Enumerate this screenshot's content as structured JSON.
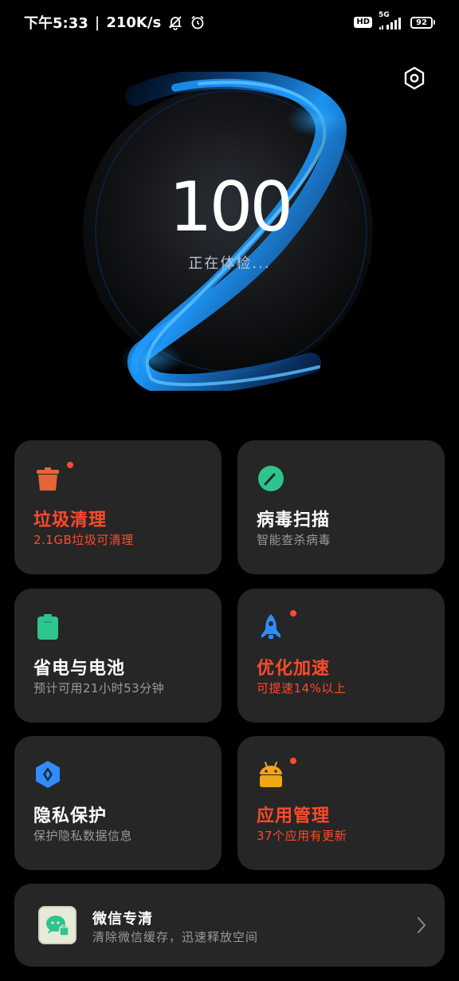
{
  "status_bar": {
    "time": "下午5:33",
    "speed": "210K/s",
    "hd": "HD",
    "net": "5G",
    "battery": "92"
  },
  "hero": {
    "score": "100",
    "status": "正在体检..."
  },
  "colors": {
    "accent_red": "#ff4a2b",
    "muted_text": "#9a9a9a",
    "card_bg": "#262626",
    "orb_blue": "#1e9bff"
  },
  "cards": [
    {
      "title": "垃圾清理",
      "sub": "2.1GB垃圾可清理",
      "icon": "trash-bin-icon",
      "badge": true
    },
    {
      "title": "病毒扫描",
      "sub": "智能查杀病毒",
      "icon": "virus-scan-icon",
      "badge": false
    },
    {
      "title": "省电与电池",
      "sub": "预计可用21小时53分钟",
      "icon": "battery-icon",
      "badge": false
    },
    {
      "title": "优化加速",
      "sub": "可提速14%以上",
      "icon": "rocket-icon",
      "badge": true
    },
    {
      "title": "隐私保护",
      "sub": "保护隐私数据信息",
      "icon": "privacy-shield-icon",
      "badge": false
    },
    {
      "title": "应用管理",
      "sub": "37个应用有更新",
      "icon": "android-app-icon",
      "badge": true
    }
  ],
  "wechat": {
    "title": "微信专清",
    "sub": "清除微信缓存，迅速释放空间",
    "icon": "wechat-clean-icon"
  }
}
